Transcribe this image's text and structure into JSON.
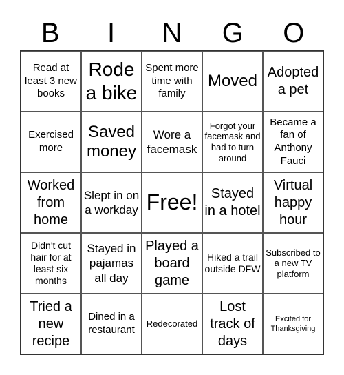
{
  "header": {
    "letters": [
      "B",
      "I",
      "N",
      "G",
      "O"
    ]
  },
  "cells": [
    [
      "Read at least 3 new books",
      "Rode a bike",
      "Spent more time with family",
      "Moved",
      "Adopted a pet"
    ],
    [
      "Exercised more",
      "Saved money",
      "Wore a facemask",
      "Forgot your facemask and had to turn around",
      "Became a fan of Anthony Fauci"
    ],
    [
      "Worked from home",
      "Slept in on a workday",
      "Free!",
      "Stayed in a hotel",
      "Virtual happy hour"
    ],
    [
      "Didn't cut hair for at least six months",
      "Stayed in pajamas all day",
      "Played a board game",
      "Hiked a trail outside DFW",
      "Subscribed to a new TV platform"
    ],
    [
      "Tried a new recipe",
      "Dined in a restaurant",
      "Redecorated",
      "Lost track of days",
      "Excited for Thanksgiving"
    ]
  ]
}
